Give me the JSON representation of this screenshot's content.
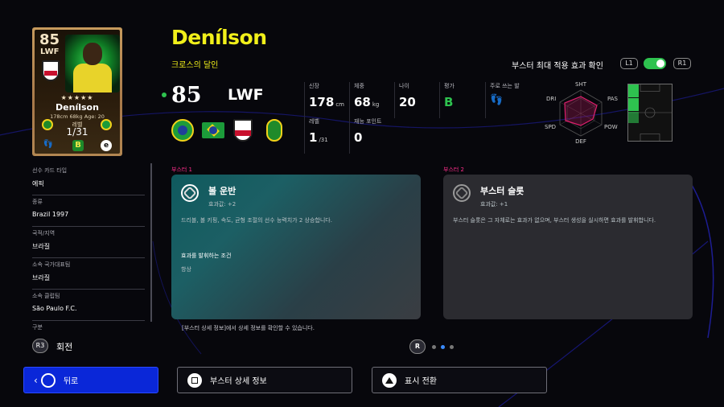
{
  "card": {
    "ovr": "85",
    "position": "LWF",
    "stars": "★★★★★",
    "name": "Denílson",
    "info": "178cm 68kg Age: 20",
    "level_label": "레벨",
    "level": "1/31",
    "grade": "B"
  },
  "player": {
    "name": "Denílson",
    "tag": "크로스의 달인",
    "ovr": "85",
    "position": "LWF"
  },
  "booster_toggle": {
    "label": "부스터 최대 적용 효과 확인",
    "left_btn": "L1",
    "right_btn": "R1",
    "on": true
  },
  "stats": {
    "height_label": "신장",
    "height": "178",
    "height_unit": "cm",
    "weight_label": "체중",
    "weight": "68",
    "weight_unit": "kg",
    "age_label": "나이",
    "age": "20",
    "rating_label": "평가",
    "rating": "B",
    "foot_label": "주로 쓰는 발",
    "level_label": "레벨",
    "level": "1",
    "level_max": "/31",
    "skill_points_label": "재능 포인트",
    "skill_points": "0"
  },
  "radar": {
    "labels": [
      "SHT",
      "PAS",
      "POW",
      "DEF",
      "SPD",
      "DRI"
    ],
    "accent": "#e0206e"
  },
  "sidebar": {
    "items": [
      {
        "key": "선수 카드 타입",
        "value": "에픽"
      },
      {
        "key": "종류",
        "value": "Brazil 1997"
      },
      {
        "key": "국적/지역",
        "value": "브라질"
      },
      {
        "key": "소속 국가대표팀",
        "value": "브라질"
      },
      {
        "key": "소속 클럽팀",
        "value": "São Paulo F.C."
      },
      {
        "key": "구분",
        "value": ""
      }
    ],
    "rotate_btn": "R3",
    "rotate_label": "회전"
  },
  "boosters": [
    {
      "header": "부스터 1",
      "title": "볼 운반",
      "effect": "효과값: +2",
      "desc": "드리블, 볼 키핑, 속도, 균형 조절의 선수 능력치가 2 상승합니다.",
      "cond_title": "효과를 발휘하는 조건",
      "cond": "항상"
    },
    {
      "header": "부스터 2",
      "title": "부스터 슬롯",
      "effect": "효과값: +1",
      "desc": "부스터 슬롯은 그 자체로는 효과가 없으며, 부스터 생성을 실시하면 효과를 발휘합니다."
    }
  ],
  "note": "[부스터 상세 정보]에서 상세 정보를 확인할 수 있습니다.",
  "pager": {
    "btn": "R",
    "pages": 3,
    "current": 1
  },
  "bottom": {
    "back": "뒤로",
    "details": "부스터 상세 정보",
    "toggle_view": "표시 전환"
  },
  "colors": {
    "accent_yellow": "#f1ef1a",
    "accent_pink": "#ff2e8c",
    "active_blue": "#0a27d8",
    "green": "#2ec24f"
  }
}
